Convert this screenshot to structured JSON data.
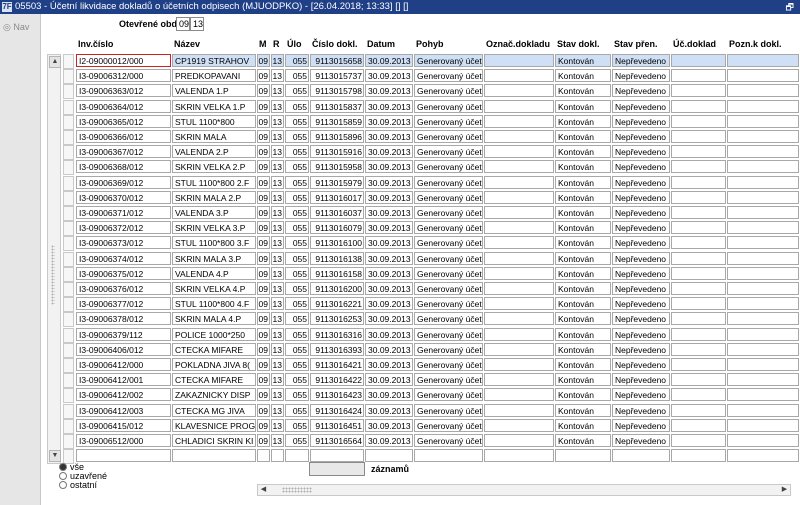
{
  "window": {
    "title": "05503 - Účetní likvidace dokladů o účetních odpisech (MJUODPKO) - [26.04.2018; 13:33] [] []",
    "app_icon": "7F",
    "restore_icon": "restore-icon",
    "restore_glyph": "🗗"
  },
  "nav": {
    "label": "Nav",
    "icon": "nav-icon",
    "glyph": "◎"
  },
  "period": {
    "label": "Otevřené období",
    "month": "09",
    "year": "13"
  },
  "columns": [
    "Inv.číslo",
    "Název",
    "M",
    "R",
    "Úlo",
    "Číslo dokl.",
    "Datum",
    "Pohyb",
    "Označ.dokladu",
    "Stav dokl.",
    "Stav přen.",
    "Úč.doklad",
    "Pozn.k dokl."
  ],
  "rows": [
    {
      "inv": "I2-09000012/000",
      "nazev": "CP1919 STRAHOV",
      "m": "09",
      "r": "13",
      "ulo": "055",
      "cislo": "9113015658",
      "datum": "30.09.2013",
      "pohyb": "Generovaný účet",
      "stav": "Kontován",
      "prenos": "Nepřevedeno"
    },
    {
      "inv": "I3-09006312/000",
      "nazev": "PREDKOPAVANI",
      "m": "09",
      "r": "13",
      "ulo": "055",
      "cislo": "9113015737",
      "datum": "30.09.2013",
      "pohyb": "Generovaný účet",
      "stav": "Kontován",
      "prenos": "Nepřevedeno"
    },
    {
      "inv": "I3-09006363/012",
      "nazev": "VALENDA 1.P",
      "m": "09",
      "r": "13",
      "ulo": "055",
      "cislo": "9113015798",
      "datum": "30.09.2013",
      "pohyb": "Generovaný účet",
      "stav": "Kontován",
      "prenos": "Nepřevedeno"
    },
    {
      "inv": "I3-09006364/012",
      "nazev": "SKRIN VELKA 1.P",
      "m": "09",
      "r": "13",
      "ulo": "055",
      "cislo": "9113015837",
      "datum": "30.09.2013",
      "pohyb": "Generovaný účet",
      "stav": "Kontován",
      "prenos": "Nepřevedeno"
    },
    {
      "inv": "I3-09006365/012",
      "nazev": "STUL 1100*800",
      "m": "09",
      "r": "13",
      "ulo": "055",
      "cislo": "9113015859",
      "datum": "30.09.2013",
      "pohyb": "Generovaný účet",
      "stav": "Kontován",
      "prenos": "Nepřevedeno"
    },
    {
      "inv": "I3-09006366/012",
      "nazev": "SKRIN MALA",
      "m": "09",
      "r": "13",
      "ulo": "055",
      "cislo": "9113015896",
      "datum": "30.09.2013",
      "pohyb": "Generovaný účet",
      "stav": "Kontován",
      "prenos": "Nepřevedeno"
    },
    {
      "inv": "I3-09006367/012",
      "nazev": "VALENDA 2.P",
      "m": "09",
      "r": "13",
      "ulo": "055",
      "cislo": "9113015916",
      "datum": "30.09.2013",
      "pohyb": "Generovaný účet",
      "stav": "Kontován",
      "prenos": "Nepřevedeno"
    },
    {
      "inv": "I3-09006368/012",
      "nazev": "SKRIN VELKA 2.P",
      "m": "09",
      "r": "13",
      "ulo": "055",
      "cislo": "9113015958",
      "datum": "30.09.2013",
      "pohyb": "Generovaný účet",
      "stav": "Kontován",
      "prenos": "Nepřevedeno"
    },
    {
      "inv": "I3-09006369/012",
      "nazev": "STUL  1100*800 2.F",
      "m": "09",
      "r": "13",
      "ulo": "055",
      "cislo": "9113015979",
      "datum": "30.09.2013",
      "pohyb": "Generovaný účet",
      "stav": "Kontován",
      "prenos": "Nepřevedeno"
    },
    {
      "inv": "I3-09006370/012",
      "nazev": "SKRIN MALA 2.P",
      "m": "09",
      "r": "13",
      "ulo": "055",
      "cislo": "9113016017",
      "datum": "30.09.2013",
      "pohyb": "Generovaný účet",
      "stav": "Kontován",
      "prenos": "Nepřevedeno"
    },
    {
      "inv": "I3-09006371/012",
      "nazev": "VALENDA 3.P",
      "m": "09",
      "r": "13",
      "ulo": "055",
      "cislo": "9113016037",
      "datum": "30.09.2013",
      "pohyb": "Generovaný účet",
      "stav": "Kontován",
      "prenos": "Nepřevedeno"
    },
    {
      "inv": "I3-09006372/012",
      "nazev": "SKRIN VELKA 3.P",
      "m": "09",
      "r": "13",
      "ulo": "055",
      "cislo": "9113016079",
      "datum": "30.09.2013",
      "pohyb": "Generovaný účet",
      "stav": "Kontován",
      "prenos": "Nepřevedeno"
    },
    {
      "inv": "I3-09006373/012",
      "nazev": "STUL  1100*800 3.F",
      "m": "09",
      "r": "13",
      "ulo": "055",
      "cislo": "9113016100",
      "datum": "30.09.2013",
      "pohyb": "Generovaný účet",
      "stav": "Kontován",
      "prenos": "Nepřevedeno"
    },
    {
      "inv": "I3-09006374/012",
      "nazev": "SKRIN MALA  3.P",
      "m": "09",
      "r": "13",
      "ulo": "055",
      "cislo": "9113016138",
      "datum": "30.09.2013",
      "pohyb": "Generovaný účet",
      "stav": "Kontován",
      "prenos": "Nepřevedeno"
    },
    {
      "inv": "I3-09006375/012",
      "nazev": "VALENDA 4.P",
      "m": "09",
      "r": "13",
      "ulo": "055",
      "cislo": "9113016158",
      "datum": "30.09.2013",
      "pohyb": "Generovaný účet",
      "stav": "Kontován",
      "prenos": "Nepřevedeno"
    },
    {
      "inv": "I3-09006376/012",
      "nazev": "SKRIN VELKA 4.P",
      "m": "09",
      "r": "13",
      "ulo": "055",
      "cislo": "9113016200",
      "datum": "30.09.2013",
      "pohyb": "Generovaný účet",
      "stav": "Kontován",
      "prenos": "Nepřevedeno"
    },
    {
      "inv": "I3-09006377/012",
      "nazev": "STUL 1100*800  4.F",
      "m": "09",
      "r": "13",
      "ulo": "055",
      "cislo": "9113016221",
      "datum": "30.09.2013",
      "pohyb": "Generovaný účet",
      "stav": "Kontován",
      "prenos": "Nepřevedeno"
    },
    {
      "inv": "I3-09006378/012",
      "nazev": "SKRIN MALA 4.P",
      "m": "09",
      "r": "13",
      "ulo": "055",
      "cislo": "9113016253",
      "datum": "30.09.2013",
      "pohyb": "Generovaný účet",
      "stav": "Kontován",
      "prenos": "Nepřevedeno"
    },
    {
      "inv": "I3-09006379/112",
      "nazev": "POLICE 1000*250",
      "m": "09",
      "r": "13",
      "ulo": "055",
      "cislo": "9113016316",
      "datum": "30.09.2013",
      "pohyb": "Generovaný účet",
      "stav": "Kontován",
      "prenos": "Nepřevedeno"
    },
    {
      "inv": "I3-09006406/012",
      "nazev": "CTECKA MIFARE",
      "m": "09",
      "r": "13",
      "ulo": "055",
      "cislo": "9113016393",
      "datum": "30.09.2013",
      "pohyb": "Generovaný účet",
      "stav": "Kontován",
      "prenos": "Nepřevedeno"
    },
    {
      "inv": "I3-09006412/000",
      "nazev": "POKLADNA JIVA 8(",
      "m": "09",
      "r": "13",
      "ulo": "055",
      "cislo": "9113016421",
      "datum": "30.09.2013",
      "pohyb": "Generovaný účet",
      "stav": "Kontován",
      "prenos": "Nepřevedeno"
    },
    {
      "inv": "I3-09006412/001",
      "nazev": "CTECKA MIFARE",
      "m": "09",
      "r": "13",
      "ulo": "055",
      "cislo": "9113016422",
      "datum": "30.09.2013",
      "pohyb": "Generovaný účet",
      "stav": "Kontován",
      "prenos": "Nepřevedeno"
    },
    {
      "inv": "I3-09006412/002",
      "nazev": "ZAKAZNICKY DISP",
      "m": "09",
      "r": "13",
      "ulo": "055",
      "cislo": "9113016423",
      "datum": "30.09.2013",
      "pohyb": "Generovaný účet",
      "stav": "Kontován",
      "prenos": "Nepřevedeno"
    },
    {
      "inv": "I3-09006412/003",
      "nazev": "CTECKA MG JIVA",
      "m": "09",
      "r": "13",
      "ulo": "055",
      "cislo": "9113016424",
      "datum": "30.09.2013",
      "pohyb": "Generovaný účet",
      "stav": "Kontován",
      "prenos": "Nepřevedeno"
    },
    {
      "inv": "I3-09006415/012",
      "nazev": "KLAVESNICE PROG",
      "m": "09",
      "r": "13",
      "ulo": "055",
      "cislo": "9113016451",
      "datum": "30.09.2013",
      "pohyb": "Generovaný účet",
      "stav": "Kontován",
      "prenos": "Nepřevedeno"
    },
    {
      "inv": "I3-09006512/000",
      "nazev": "CHLADICI SKRIN KI",
      "m": "09",
      "r": "13",
      "ulo": "055",
      "cislo": "9113016564",
      "datum": "30.09.2013",
      "pohyb": "Generovaný účet",
      "stav": "Kontován",
      "prenos": "Nepřevedeno"
    }
  ],
  "filter": {
    "options": [
      {
        "label": "vše",
        "selected": true
      },
      {
        "label": "uzavřené",
        "selected": false
      },
      {
        "label": "ostatní",
        "selected": false
      }
    ]
  },
  "record_count": {
    "value": "",
    "label": "záznamů"
  },
  "scroll_icons": {
    "up": "▲",
    "down": "▼",
    "left": "◀",
    "right": "▶"
  },
  "colors": {
    "titlebar": "#1f3f86",
    "selected_row": "#cfe0f6",
    "active_cell_border": "#d02020"
  }
}
